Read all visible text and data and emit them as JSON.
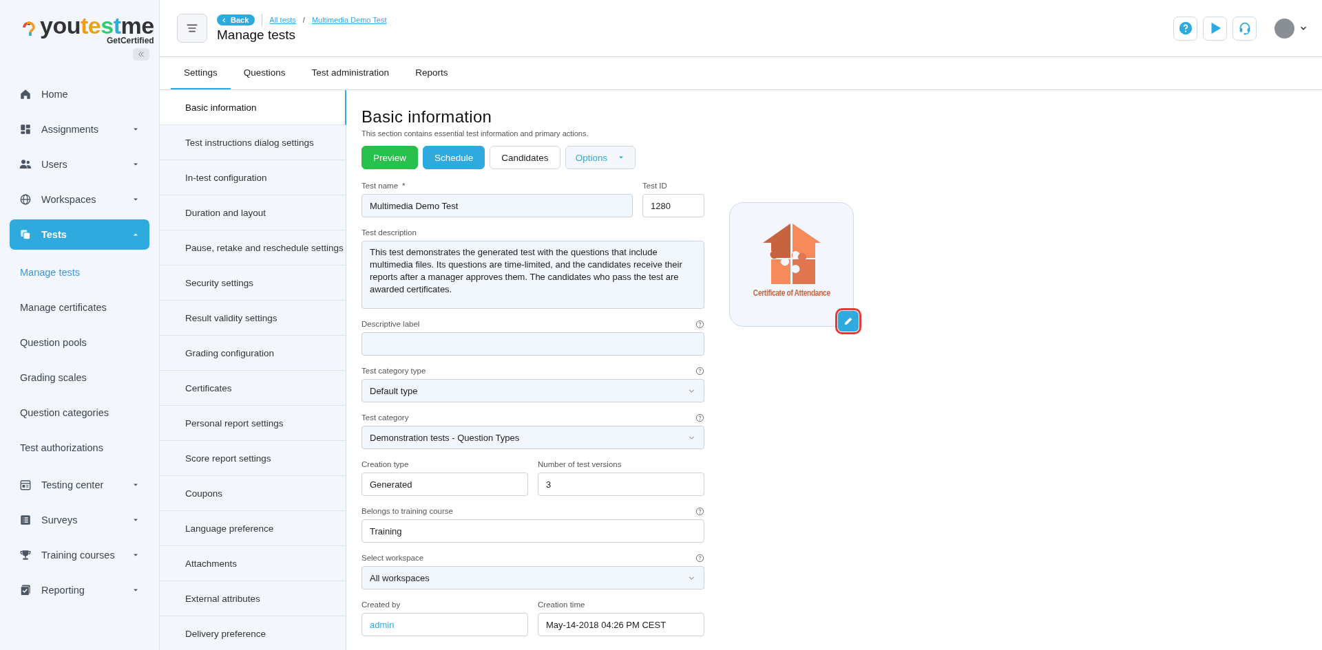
{
  "logo": {
    "name": "youtestme",
    "tagline": "GetCertified"
  },
  "sidebar": {
    "items": [
      {
        "label": "Home",
        "kind": "link",
        "selected": false
      },
      {
        "label": "Assignments",
        "kind": "group",
        "selected": false,
        "expanded": false
      },
      {
        "label": "Users",
        "kind": "group",
        "selected": false,
        "expanded": false
      },
      {
        "label": "Workspaces",
        "kind": "group",
        "selected": false,
        "expanded": false
      },
      {
        "label": "Tests",
        "kind": "group",
        "selected": true,
        "expanded": true,
        "children": [
          {
            "label": "Manage tests",
            "selected": true
          },
          {
            "label": "Manage certificates",
            "selected": false
          },
          {
            "label": "Question pools",
            "selected": false
          },
          {
            "label": "Grading scales",
            "selected": false
          },
          {
            "label": "Question categories",
            "selected": false
          },
          {
            "label": "Test authorizations",
            "selected": false
          }
        ]
      },
      {
        "label": "Testing center",
        "kind": "group",
        "selected": false,
        "expanded": false
      },
      {
        "label": "Surveys",
        "kind": "group",
        "selected": false,
        "expanded": false
      },
      {
        "label": "Training courses",
        "kind": "group",
        "selected": false,
        "expanded": false
      },
      {
        "label": "Reporting",
        "kind": "group",
        "selected": false,
        "expanded": false
      }
    ]
  },
  "header": {
    "back": "Back",
    "breadcrumbs": [
      "All tests",
      "Multimedia Demo Test"
    ],
    "separator": "/",
    "title": "Manage tests"
  },
  "tabs": [
    {
      "label": "Settings",
      "selected": true
    },
    {
      "label": "Questions",
      "selected": false
    },
    {
      "label": "Test administration",
      "selected": false
    },
    {
      "label": "Reports",
      "selected": false
    }
  ],
  "settings_nav": [
    {
      "label": "Basic information",
      "selected": true
    },
    {
      "label": "Test instructions dialog settings",
      "selected": false
    },
    {
      "label": "In-test configuration",
      "selected": false
    },
    {
      "label": "Duration and layout",
      "selected": false
    },
    {
      "label": "Pause, retake and reschedule settings",
      "selected": false
    },
    {
      "label": "Security settings",
      "selected": false
    },
    {
      "label": "Result validity settings",
      "selected": false
    },
    {
      "label": "Grading configuration",
      "selected": false
    },
    {
      "label": "Certificates",
      "selected": false
    },
    {
      "label": "Personal report settings",
      "selected": false
    },
    {
      "label": "Score report settings",
      "selected": false
    },
    {
      "label": "Coupons",
      "selected": false
    },
    {
      "label": "Language preference",
      "selected": false
    },
    {
      "label": "Attachments",
      "selected": false
    },
    {
      "label": "External attributes",
      "selected": false
    },
    {
      "label": "Delivery preference",
      "selected": false
    }
  ],
  "section": {
    "title": "Basic information",
    "subtitle": "This section contains essential test information and primary actions.",
    "buttons": [
      {
        "label": "Preview",
        "kind": "success"
      },
      {
        "label": "Schedule",
        "kind": "primary"
      },
      {
        "label": "Candidates",
        "kind": "outline"
      },
      {
        "label": "Options",
        "kind": "dropdown"
      }
    ],
    "rows": [
      [
        {
          "label": "Test name",
          "required_mark": "*",
          "kind": "text",
          "value": "Multimedia Demo Test",
          "readonly": false,
          "help": false
        },
        {
          "label": "Test ID",
          "kind": "text",
          "value": "1280",
          "readonly": true,
          "help": false
        }
      ],
      [
        {
          "label": "Test description",
          "kind": "textarea",
          "value": "This test demonstrates the generated test with the questions that include multimedia files. Its questions are time-limited, and the candidates receive their reports after a manager approves them. The candidates who pass the test are awarded certificates.",
          "readonly": false,
          "help": false
        }
      ],
      [
        {
          "label": "Descriptive label",
          "kind": "text",
          "readonly": false,
          "help": true
        }
      ],
      [
        {
          "label": "Test category type",
          "kind": "select",
          "value": "Default type",
          "readonly": false,
          "help": true
        }
      ],
      [
        {
          "label": "Test category",
          "kind": "select",
          "value": "Demonstration tests - Question Types",
          "readonly": false,
          "help": true
        }
      ],
      [
        {
          "label": "Creation type",
          "kind": "text",
          "value": "Generated",
          "readonly": true,
          "help": false
        },
        {
          "label": "Number of test versions",
          "kind": "text",
          "value": "3",
          "readonly": true,
          "help": false
        }
      ],
      [
        {
          "label": "Belongs to training course",
          "kind": "text",
          "value": "Training",
          "readonly": true,
          "help": true
        }
      ],
      [
        {
          "label": "Select workspace",
          "kind": "select",
          "value": "All workspaces",
          "readonly": false,
          "help": true
        }
      ],
      [
        {
          "label": "Created by",
          "kind": "link",
          "value": "admin",
          "readonly": true,
          "help": false
        },
        {
          "label": "Creation time",
          "kind": "text",
          "value": "May-14-2018 04:26 PM CEST",
          "readonly": true,
          "help": false
        }
      ]
    ]
  },
  "certificate": {
    "caption": "Certificate of Attendance",
    "edit_highlighted": true
  }
}
